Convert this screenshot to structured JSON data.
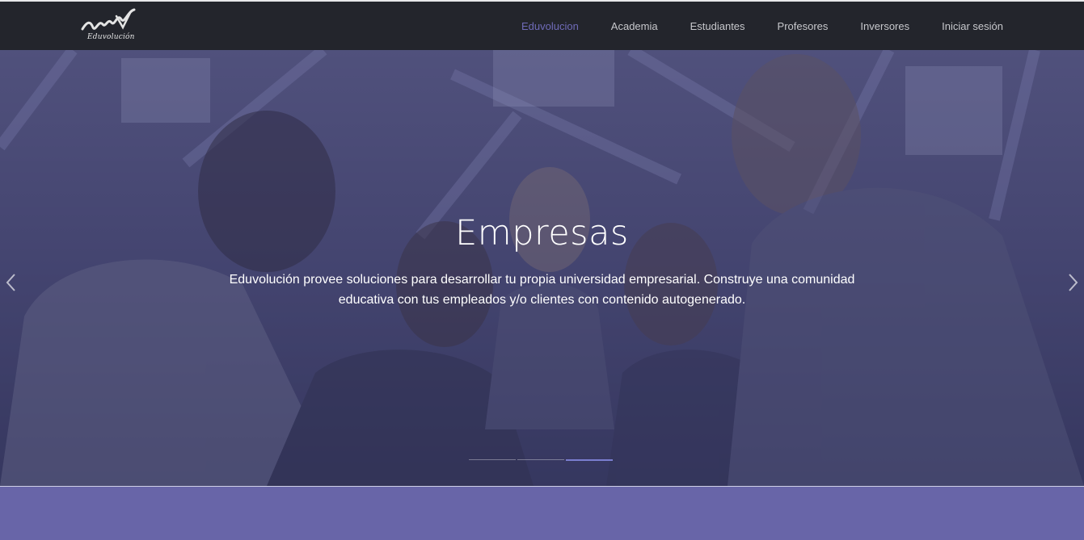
{
  "brand": {
    "name": "Eduvolución"
  },
  "nav": {
    "items": [
      {
        "label": "Eduvolucion",
        "active": true
      },
      {
        "label": "Academia"
      },
      {
        "label": "Estudiantes"
      },
      {
        "label": "Profesores"
      },
      {
        "label": "Inversores"
      },
      {
        "label": "Iniciar sesión"
      }
    ]
  },
  "hero": {
    "title": "Empresas",
    "text": "Eduvolución provee soluciones para desarrollar tu propia universidad empresarial. Construye una comunidad educativa con tus empleados y/o clientes con contenido autogenerado.",
    "prev_icon": "chevron-left-icon",
    "next_icon": "chevron-right-icon",
    "slide_count": 3,
    "active_slide": 3
  },
  "colors": {
    "navbar": "#23252c",
    "accent": "#6f6bb8",
    "band": "#6865a8"
  }
}
